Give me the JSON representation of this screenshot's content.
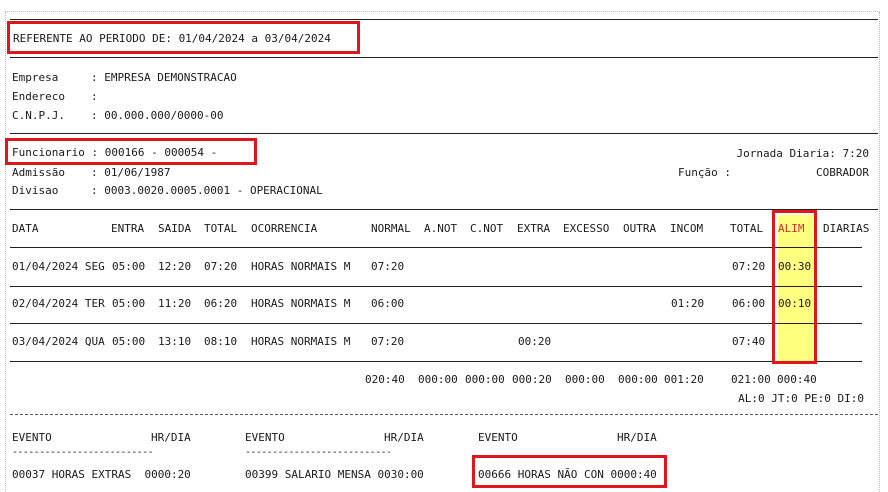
{
  "header": {
    "period": "REFERENTE AO PERIODO DE: 01/04/2024 a 03/04/2024"
  },
  "company": {
    "empresa_label": "Empresa",
    "empresa_value": ": EMPRESA DEMONSTRACAO",
    "endereco_label": "Endereco",
    "endereco_value": ":",
    "cnpj_label": "C.N.P.J.",
    "cnpj_value": ": 00.000.000/0000-00"
  },
  "employee": {
    "funcionario": "Funcionario : 000166 - 000054 -",
    "jornada": "Jornada Diaria: 7:20",
    "admissao_label": "Admissão",
    "admissao_value": ": 01/06/1987",
    "funcao_label": "Função :",
    "funcao_value": "COBRADOR",
    "divisao_label": "Divisao",
    "divisao_value": ": 0003.0020.0005.0001 - OPERACIONAL"
  },
  "table": {
    "headers": {
      "data": "DATA",
      "entra": "ENTRA",
      "saida": "SAIDA",
      "total": "TOTAL",
      "ocorrencia": "OCORRENCIA",
      "normal": "NORMAL",
      "anot": "A.NOT",
      "cnot": "C.NOT",
      "extra": "EXTRA",
      "excesso": "EXCESSO",
      "outra": "OUTRA",
      "incom": "INCOM",
      "total2": "TOTAL",
      "alim": "ALIM",
      "diarias": "DIARIAS"
    },
    "rows": [
      {
        "data": "01/04/2024 SEG",
        "entra": "05:00",
        "saida": "12:20",
        "total": "07:20",
        "ocorrencia": "HORAS NORMAIS M",
        "normal": "07:20",
        "extra": "",
        "incom": "",
        "total2": "07:20",
        "alim": "00:30"
      },
      {
        "data": "02/04/2024 TER",
        "entra": "05:00",
        "saida": "11:20",
        "total": "06:20",
        "ocorrencia": "HORAS NORMAIS M",
        "normal": "06:00",
        "extra": "",
        "incom": "01:20",
        "total2": "06:00",
        "alim": "00:10"
      },
      {
        "data": "03/04/2024 QUA",
        "entra": "05:00",
        "saida": "13:10",
        "total": "08:10",
        "ocorrencia": "HORAS NORMAIS M",
        "normal": "07:20",
        "extra": "00:20",
        "incom": "",
        "total2": "07:40",
        "alim": ""
      }
    ],
    "totals": {
      "normal": "020:40",
      "anot": "000:00",
      "cnot": "000:00",
      "extra": "000:20",
      "excesso": "000:00",
      "outra": "000:00",
      "incom": "001:20",
      "total2": "021:00",
      "alim": "000:40"
    },
    "summary": "AL:0 JT:0 PE:0 DI:0"
  },
  "events": {
    "col_label": "EVENTO",
    "hr_label": "HR/DIA",
    "underline_a": "--------------------------",
    "underline_b": "---------------------------",
    "items": [
      "00037 HORAS EXTRAS  0000:20",
      "00399 SALARIO MENSA 0030:00",
      "00666 HORAS NÃO CON 0000:40"
    ]
  },
  "colors": {
    "highlight_border": "#e0161e",
    "highlight_fill": "#ffff80"
  }
}
